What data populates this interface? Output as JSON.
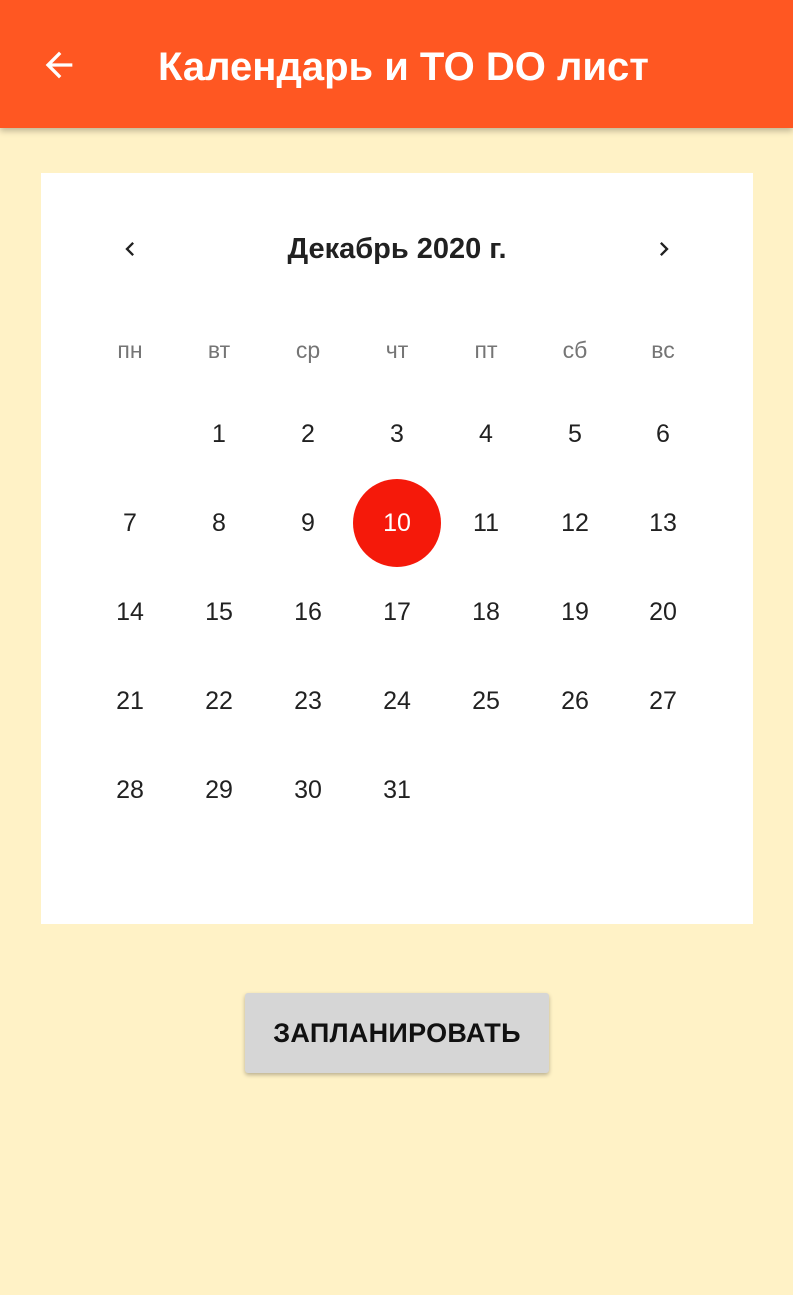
{
  "app_bar": {
    "title": "Календарь и TO DO лист",
    "back_icon": "arrow-left-icon",
    "background": "#FF5722"
  },
  "calendar": {
    "month_label": "Декабрь 2020 г.",
    "prev_icon": "chevron-left-icon",
    "next_icon": "chevron-right-icon",
    "weekdays": [
      "пн",
      "вт",
      "ср",
      "чт",
      "пт",
      "сб",
      "вс"
    ],
    "first_weekday_index": 1,
    "days": [
      "1",
      "2",
      "3",
      "4",
      "5",
      "6",
      "7",
      "8",
      "9",
      "10",
      "11",
      "12",
      "13",
      "14",
      "15",
      "16",
      "17",
      "18",
      "19",
      "20",
      "21",
      "22",
      "23",
      "24",
      "25",
      "26",
      "27",
      "28",
      "29",
      "30",
      "31"
    ],
    "selected_day": "10",
    "selected_color": "#F5190A"
  },
  "schedule_button": {
    "label": "ЗАПЛАНИРОВАТЬ"
  },
  "colors": {
    "page_background": "#FFF2C6",
    "card_background": "#FFFFFF",
    "button_background": "#D6D6D6"
  }
}
